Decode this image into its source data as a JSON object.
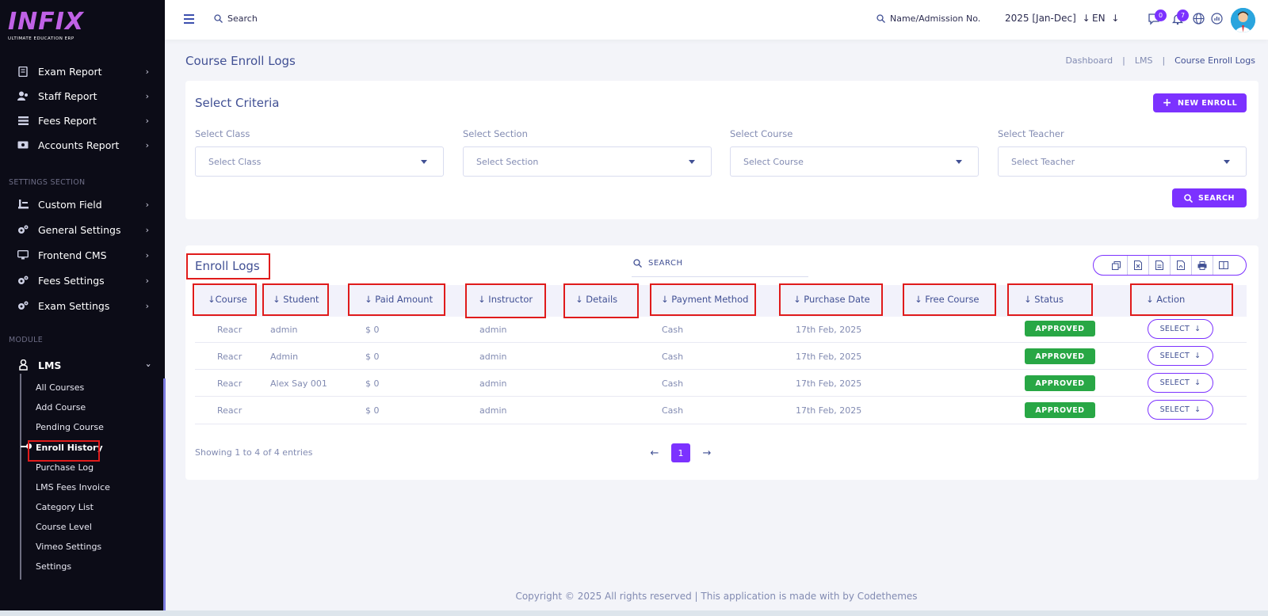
{
  "sidebar": {
    "logo": "INFIX",
    "logo_subtitle": "ULTIMATE EDUCATION ERP",
    "report_items": [
      {
        "label": "Exam Report",
        "icon": "document-icon"
      },
      {
        "label": "Staff Report",
        "icon": "users-icon"
      },
      {
        "label": "Fees Report",
        "icon": "list-icon"
      },
      {
        "label": "Accounts Report",
        "icon": "money-icon"
      }
    ],
    "settings_section_title": "SETTINGS SECTION",
    "settings_items": [
      {
        "label": "Custom Field",
        "icon": "field-icon"
      },
      {
        "label": "General Settings",
        "icon": "gears-icon"
      },
      {
        "label": "Frontend CMS",
        "icon": "monitor-icon"
      },
      {
        "label": "Fees Settings",
        "icon": "gears-icon"
      },
      {
        "label": "Exam Settings",
        "icon": "gears-icon"
      }
    ],
    "module_section_title": "MODULE",
    "module_label": "LMS",
    "lms_items": [
      "All Courses",
      "Add Course",
      "Pending Course",
      "Enroll History",
      "Purchase Log",
      "LMS Fees Invoice",
      "Category List",
      "Course Level",
      "Vimeo Settings",
      "Settings"
    ],
    "active_item": "Enroll History"
  },
  "topbar": {
    "search_label": "Search",
    "admission_search_label": "Name/Admission No.",
    "year": "2025 [Jan-Dec]",
    "language": "EN",
    "messages_count": "0",
    "notifications_count": "7"
  },
  "page": {
    "title": "Course Enroll Logs",
    "breadcrumb": [
      "Dashboard",
      "LMS",
      "Course Enroll Logs"
    ],
    "separator": "|"
  },
  "criteria": {
    "title": "Select Criteria",
    "new_enroll_label": "NEW ENROLL",
    "fields": [
      {
        "label": "Select Class",
        "placeholder": "Select Class"
      },
      {
        "label": "Select Section",
        "placeholder": "Select Section"
      },
      {
        "label": "Select Course",
        "placeholder": "Select Course"
      },
      {
        "label": "Select Teacher",
        "placeholder": "Select Teacher"
      }
    ],
    "search_label": "SEARCH"
  },
  "enroll_logs": {
    "title": "Enroll Logs",
    "search_placeholder": "SEARCH",
    "columns": [
      "Course",
      "Student",
      "Paid Amount",
      "Instructor",
      "Details",
      "Payment Method",
      "Purchase Date",
      "Free Course",
      "Status",
      "Action"
    ],
    "rows": [
      {
        "course": "Reacr",
        "student": "admin",
        "paid": "$ 0",
        "instructor": "admin",
        "details": "",
        "method": "Cash",
        "date": "17th Feb, 2025",
        "free": "",
        "status": "APPROVED",
        "action": "SELECT"
      },
      {
        "course": "Reacr",
        "student": "Admin",
        "paid": "$ 0",
        "instructor": "admin",
        "details": "",
        "method": "Cash",
        "date": "17th Feb, 2025",
        "free": "",
        "status": "APPROVED",
        "action": "SELECT"
      },
      {
        "course": "Reacr",
        "student": "Alex Say 001",
        "paid": "$ 0",
        "instructor": "admin",
        "details": "",
        "method": "Cash",
        "date": "17th Feb, 2025",
        "free": "",
        "status": "APPROVED",
        "action": "SELECT"
      },
      {
        "course": "Reacr",
        "student": "",
        "paid": "$ 0",
        "instructor": "admin",
        "details": "",
        "method": "Cash",
        "date": "17th Feb, 2025",
        "free": "",
        "status": "APPROVED",
        "action": "SELECT"
      }
    ],
    "showing": "Showing 1 to 4 of 4 entries",
    "current_page": "1"
  },
  "footer": "Copyright © 2025 All rights reserved | This application is made with by Codethemes",
  "colors": {
    "primary": "#7c32ff",
    "text": "#415094",
    "muted": "#828bb2",
    "approved": "#28a745",
    "sidebar_bg": "#0c0c17",
    "highlight": "#e01b1b"
  }
}
